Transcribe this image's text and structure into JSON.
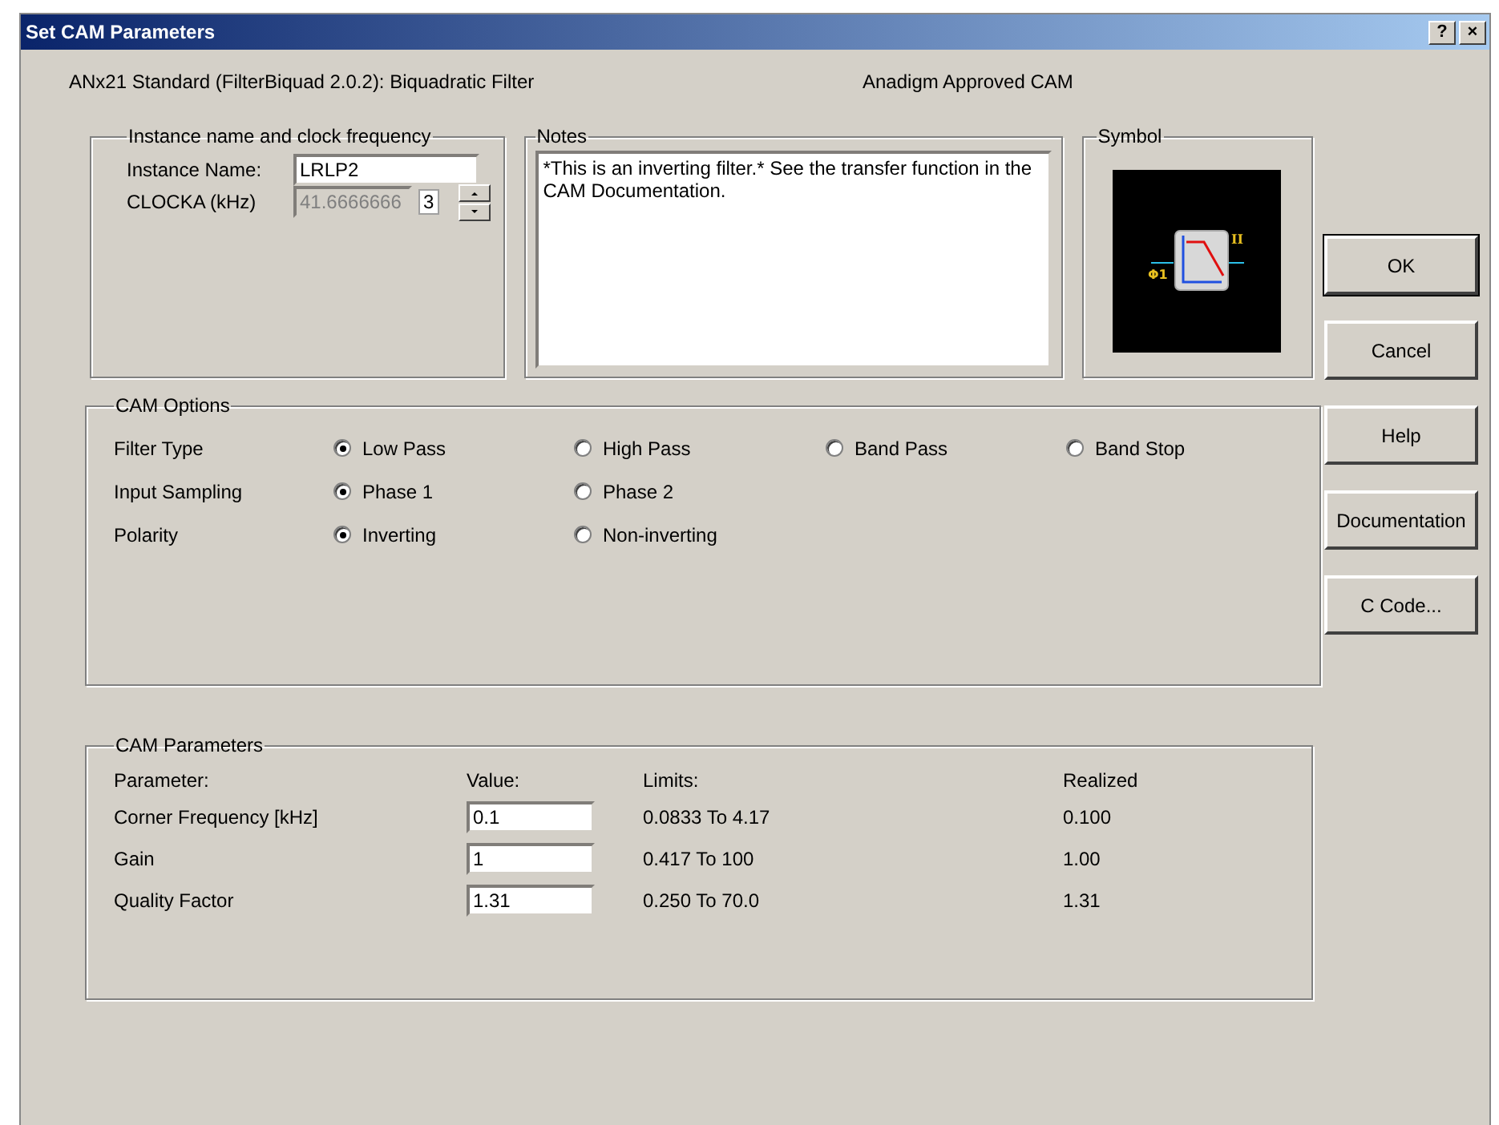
{
  "window": {
    "title": "Set CAM Parameters",
    "help_button": "?",
    "close_button": "×"
  },
  "header": {
    "cam_name": "ANx21 Standard (FilterBiquad 2.0.2):  Biquadratic Filter",
    "approval": "Anadigm Approved CAM"
  },
  "instance": {
    "title": "Instance name and clock frequency",
    "name_label": "Instance Name:",
    "name_value": "LRLP2",
    "clock_label": "CLOCKA (kHz)",
    "clock_value": "41.6666666",
    "divider_value": "3"
  },
  "notes": {
    "title": "Notes",
    "text": "*This is an inverting filter.*  See the transfer function in the CAM Documentation."
  },
  "symbol": {
    "title": "Symbol",
    "input_label": "Φ1",
    "output_label": "II"
  },
  "buttons": [
    "OK",
    "Cancel",
    "Help",
    "Documentation",
    "C Code..."
  ],
  "cam_options": {
    "title": "CAM Options",
    "rows": [
      {
        "label": "Filter Type",
        "options": [
          {
            "label": "Low Pass",
            "selected": true
          },
          {
            "label": "High Pass",
            "selected": false
          },
          {
            "label": "Band Pass",
            "selected": false
          },
          {
            "label": "Band Stop",
            "selected": false
          }
        ]
      },
      {
        "label": "Input Sampling",
        "options": [
          {
            "label": "Phase 1",
            "selected": true
          },
          {
            "label": "Phase 2",
            "selected": false
          }
        ]
      },
      {
        "label": "Polarity",
        "options": [
          {
            "label": "Inverting",
            "selected": true
          },
          {
            "label": "Non-inverting",
            "selected": false
          }
        ]
      }
    ]
  },
  "cam_parameters": {
    "title": "CAM Parameters",
    "columns": [
      "Parameter:",
      "Value:",
      "Limits:",
      "Realized"
    ],
    "rows": [
      {
        "parameter": "Corner Frequency [kHz]",
        "value": "0.1",
        "limits": "0.0833 To 4.17",
        "realized": "0.100"
      },
      {
        "parameter": "Gain",
        "value": "1",
        "limits": "0.417 To 100",
        "realized": "1.00"
      },
      {
        "parameter": "Quality Factor",
        "value": "1.31",
        "limits": "0.250 To 70.0",
        "realized": "1.31"
      }
    ]
  }
}
